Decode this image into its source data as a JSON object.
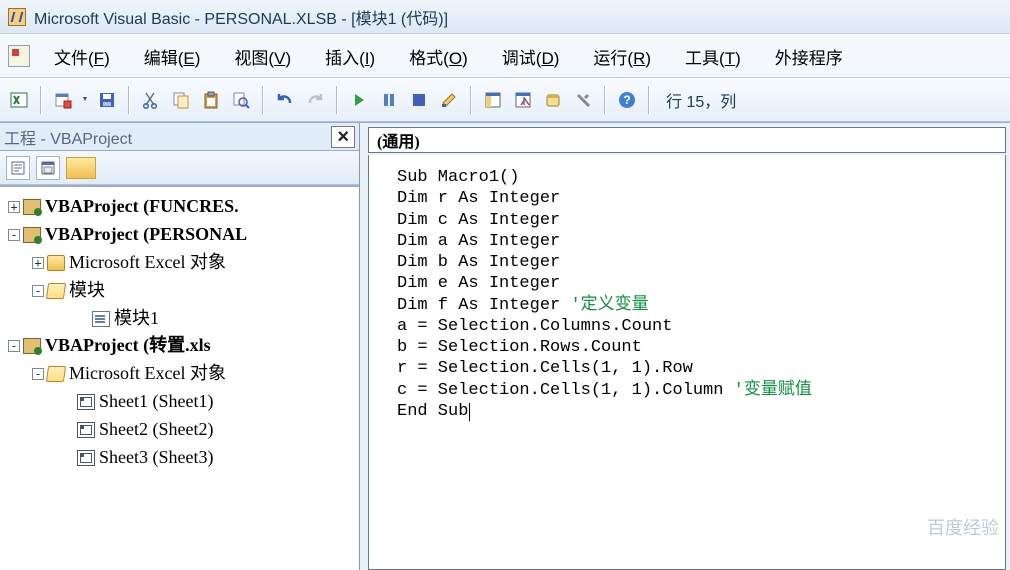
{
  "title": "Microsoft Visual Basic - PERSONAL.XLSB - [模块1 (代码)]",
  "menu": {
    "file": "文件(F)",
    "edit": "编辑(E)",
    "view": "视图(V)",
    "insert": "插入(I)",
    "format": "格式(O)",
    "debug": "调试(D)",
    "run": "运行(R)",
    "tools": "工具(T)",
    "addins": "外接程序"
  },
  "toolbar": {
    "position": "行 15，列"
  },
  "project_pane": {
    "title": "工程 - VBAProject",
    "close": "×"
  },
  "tree": {
    "proj1": "VBAProject (FUNCRES.",
    "proj2": "VBAProject (PERSONAL",
    "excel_objects": "Microsoft Excel 对象",
    "modules": "模块",
    "module1": "模块1",
    "proj3": "VBAProject (转置.xls",
    "excel_objects2": "Microsoft Excel 对象",
    "sheet1": "Sheet1 (Sheet1)",
    "sheet2": "Sheet2 (Sheet2)",
    "sheet3": "Sheet3 (Sheet3)"
  },
  "code": {
    "obj_dropdown": "(通用)",
    "line1": "Sub Macro1()",
    "blank": "",
    "line2": "Dim r As Integer",
    "line3": "Dim c As Integer",
    "line4": "Dim a As Integer",
    "line5": "Dim b As Integer",
    "line6": "Dim e As Integer",
    "line7a": "Dim f As Integer ",
    "line7c": "'定义变量",
    "line8": "a = Selection.Columns.Count",
    "line9": "b = Selection.Rows.Count",
    "line10": "r = Selection.Cells(1, 1).Row",
    "line11a": "c = Selection.Cells(1, 1).Column ",
    "line11c": "'变量赋值",
    "line12": "End Sub"
  },
  "watermark": "百度经验"
}
